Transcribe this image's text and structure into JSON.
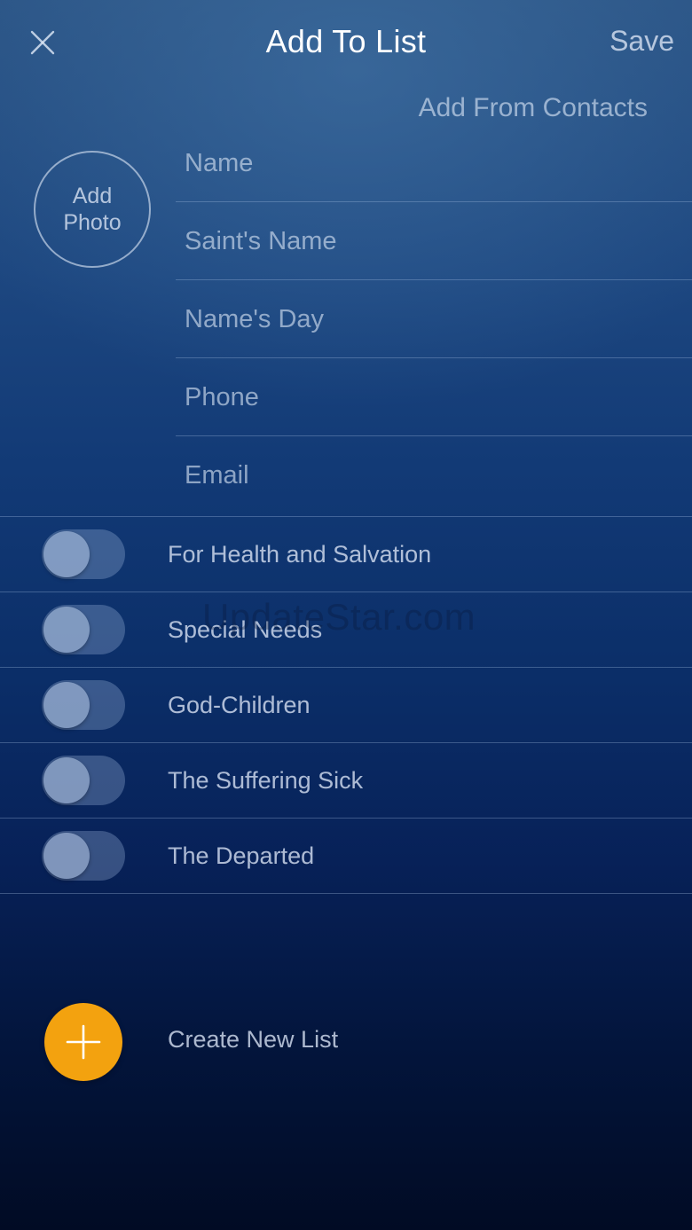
{
  "header": {
    "close_icon": "close-icon",
    "title": "Add To List",
    "save_label": "Save",
    "add_from_contacts_label": "Add From Contacts"
  },
  "photo": {
    "label": "Add\nPhoto"
  },
  "form": {
    "fields": [
      {
        "placeholder": "Name",
        "value": ""
      },
      {
        "placeholder": "Saint's Name",
        "value": ""
      },
      {
        "placeholder": "Name's Day",
        "value": ""
      },
      {
        "placeholder": "Phone",
        "value": ""
      },
      {
        "placeholder": "Email",
        "value": ""
      }
    ]
  },
  "lists": [
    {
      "label": "For Health and Salvation",
      "enabled": false
    },
    {
      "label": "Special Needs",
      "enabled": false
    },
    {
      "label": "God-Children",
      "enabled": false
    },
    {
      "label": "The Suffering Sick",
      "enabled": false
    },
    {
      "label": "The Departed",
      "enabled": false
    }
  ],
  "watermark": "UpdateStar.com",
  "create": {
    "icon": "plus-icon",
    "label": "Create New List"
  },
  "colors": {
    "accent": "#f3a20f",
    "background_top": "#2a5384",
    "background_bottom": "#010b24"
  }
}
